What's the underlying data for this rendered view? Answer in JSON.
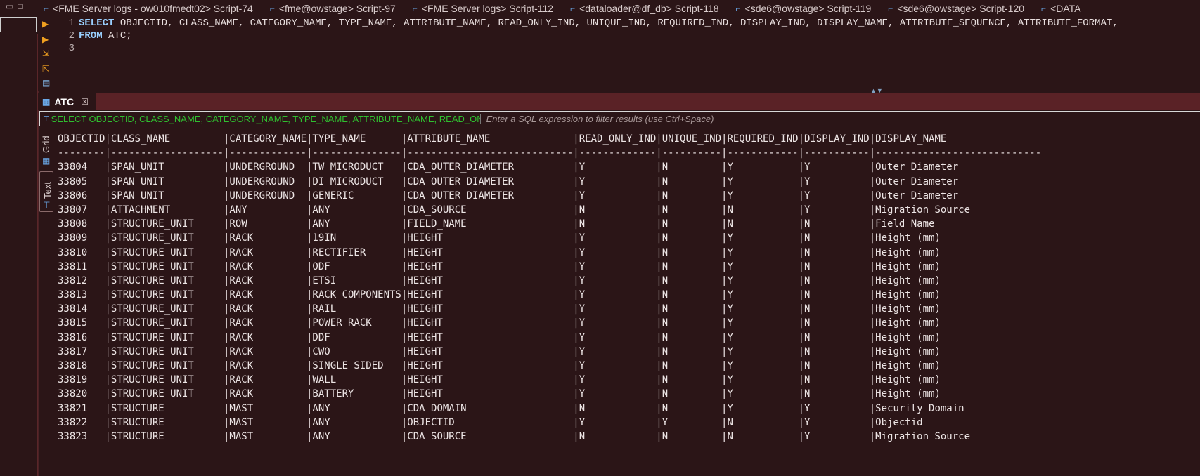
{
  "window": {
    "minimize_glyph": "▭",
    "restore_glyph": "□"
  },
  "tabs": [
    {
      "label": "<FME Server logs - ow010fmedt02> Script-74"
    },
    {
      "label": "<fme@owstage> Script-97"
    },
    {
      "label": "<FME Server logs> Script-112"
    },
    {
      "label": "<dataloader@df_db> Script-118"
    },
    {
      "label": "<sde6@owstage> Script-119"
    },
    {
      "label": "<sde6@owstage> Script-120"
    },
    {
      "label": "<DATA"
    }
  ],
  "editor": {
    "lines": [
      {
        "num": "1",
        "keyword": "SELECT",
        "text": " OBJECTID, CLASS_NAME, CATEGORY_NAME, TYPE_NAME, ATTRIBUTE_NAME, READ_ONLY_IND, UNIQUE_IND, REQUIRED_IND, DISPLAY_IND, DISPLAY_NAME, ATTRIBUTE_SEQUENCE, ATTRIBUTE_FORMAT,"
      },
      {
        "num": "2",
        "keyword": "FROM",
        "text": " ATC;"
      },
      {
        "num": "3",
        "keyword": "",
        "text": ""
      }
    ]
  },
  "results": {
    "tab_label": "ATC",
    "close_glyph": "☒",
    "filter_sql": "SELECT OBJECTID, CLASS_NAME, CATEGORY_NAME, TYPE_NAME, ATTRIBUTE_NAME, READ_ONLY_I",
    "filter_placeholder": "Enter a SQL expression to filter results (use Ctrl+Space)",
    "view_grid_label": "Grid",
    "view_text_label": "Text",
    "text_lines": [
      "OBJECTID|CLASS_NAME         |CATEGORY_NAME|TYPE_NAME      |ATTRIBUTE_NAME              |READ_ONLY_IND|UNIQUE_IND|REQUIRED_IND|DISPLAY_IND|DISPLAY_NAME",
      "--------|-------------------|-------------|---------------|----------------------------|-------------|----------|------------|-----------|----------------------------",
      "33804   |SPAN_UNIT          |UNDERGROUND  |TW MICRODUCT   |CDA_OUTER_DIAMETER          |Y            |N         |Y           |Y          |Outer Diameter",
      "33805   |SPAN_UNIT          |UNDERGROUND  |DI MICRODUCT   |CDA_OUTER_DIAMETER          |Y            |N         |Y           |Y          |Outer Diameter",
      "33806   |SPAN_UNIT          |UNDERGROUND  |GENERIC        |CDA_OUTER_DIAMETER          |Y            |N         |Y           |Y          |Outer Diameter",
      "33807   |ATTACHMENT         |ANY          |ANY            |CDA_SOURCE                  |N            |N         |N           |Y          |Migration Source",
      "33808   |STRUCTURE_UNIT     |ROW          |ANY            |FIELD_NAME                  |N            |N         |N           |N          |Field Name",
      "33809   |STRUCTURE_UNIT     |RACK         |19IN           |HEIGHT                      |Y            |N         |Y           |N          |Height (mm)",
      "33810   |STRUCTURE_UNIT     |RACK         |RECTIFIER      |HEIGHT                      |Y            |N         |Y           |N          |Height (mm)",
      "33811   |STRUCTURE_UNIT     |RACK         |ODF            |HEIGHT                      |Y            |N         |Y           |N          |Height (mm)",
      "33812   |STRUCTURE_UNIT     |RACK         |ETSI           |HEIGHT                      |Y            |N         |Y           |N          |Height (mm)",
      "33813   |STRUCTURE_UNIT     |RACK         |RACK COMPONENTS|HEIGHT                      |Y            |N         |Y           |N          |Height (mm)",
      "33814   |STRUCTURE_UNIT     |RACK         |RAIL           |HEIGHT                      |Y            |N         |Y           |N          |Height (mm)",
      "33815   |STRUCTURE_UNIT     |RACK         |POWER RACK     |HEIGHT                      |Y            |N         |Y           |N          |Height (mm)",
      "33816   |STRUCTURE_UNIT     |RACK         |DDF            |HEIGHT                      |Y            |N         |Y           |N          |Height (mm)",
      "33817   |STRUCTURE_UNIT     |RACK         |CWO            |HEIGHT                      |Y            |N         |Y           |N          |Height (mm)",
      "33818   |STRUCTURE_UNIT     |RACK         |SINGLE SIDED   |HEIGHT                      |Y            |N         |Y           |N          |Height (mm)",
      "33819   |STRUCTURE_UNIT     |RACK         |WALL           |HEIGHT                      |Y            |N         |Y           |N          |Height (mm)",
      "33820   |STRUCTURE_UNIT     |RACK         |BATTERY        |HEIGHT                      |Y            |N         |Y           |N          |Height (mm)",
      "33821   |STRUCTURE          |MAST         |ANY            |CDA_DOMAIN                  |N            |N         |Y           |Y          |Security Domain",
      "33822   |STRUCTURE          |MAST         |ANY            |OBJECTID                    |Y            |Y         |N           |Y          |Objectid",
      "33823   |STRUCTURE          |MAST         |ANY            |CDA_SOURCE                  |N            |N         |N           |Y          |Migration Source"
    ]
  },
  "icons": {
    "tab": "script-icon",
    "result_tab": "table-icon",
    "filter": "filter-icon",
    "grid": "grid-icon",
    "text": "text-view-icon"
  },
  "colors": {
    "background": "#2b1517",
    "panel_header": "#5a2226",
    "keyword": "#9ad0ff",
    "filter_sql": "#2fbf2f",
    "run_arrow": "#f0a020"
  }
}
